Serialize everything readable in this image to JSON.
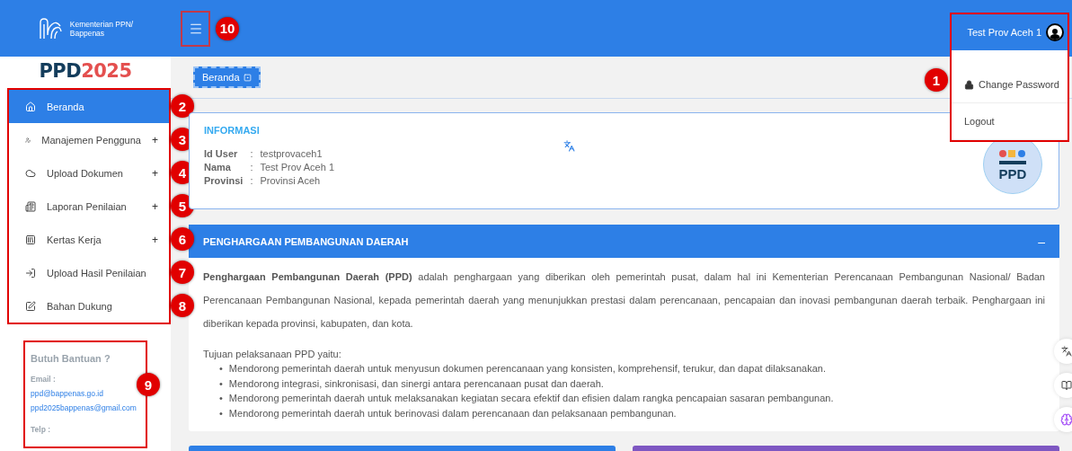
{
  "header": {
    "brand_lines": [
      "Kementerian PPN/",
      "Bappenas"
    ],
    "menu_marker": "10",
    "user_name": "Test Prov Aceh 1"
  },
  "user_menu": {
    "marker": "1",
    "items": [
      {
        "label": "Change Password",
        "kind": "lock"
      },
      {
        "label": "Logout",
        "kind": "plain"
      }
    ]
  },
  "sidebar": {
    "logo": [
      "PPD",
      "2025"
    ],
    "items": [
      {
        "label": "Beranda",
        "selected": true,
        "marker": "2"
      },
      {
        "label": "Manajemen Pengguna",
        "selected": false,
        "expand": "+",
        "marker": "3"
      },
      {
        "label": "Upload Dokumen",
        "selected": false,
        "expand": "+",
        "marker": "4"
      },
      {
        "label": "Laporan Penilaian",
        "selected": false,
        "expand": "+",
        "marker": "5"
      },
      {
        "label": "Kertas Kerja",
        "selected": false,
        "expand": "+",
        "marker": "6"
      },
      {
        "label": "Upload Hasil Penilaian",
        "selected": false,
        "marker": "7"
      },
      {
        "label": "Bahan Dukung",
        "selected": false,
        "marker": "8"
      }
    ],
    "help": {
      "marker": "9",
      "title": "Butuh Bantuan ?",
      "email_label": "Email :",
      "emails": [
        "ppd@bappenas.go.id",
        "ppd2025bappenas@gmail.com"
      ],
      "phone_label": "Telp :"
    }
  },
  "breadcrumb": {
    "label": "Beranda"
  },
  "info": {
    "title": "INFORMASI",
    "fields": [
      {
        "label": "Id User",
        "separator": ":",
        "value": "testprovaceh1"
      },
      {
        "label": "Nama",
        "separator": ":",
        "value": "Test Prov Aceh 1"
      },
      {
        "label": "Provinsi",
        "separator": ":",
        "value": "Provinsi Aceh"
      }
    ],
    "badge": "PPD"
  },
  "section": {
    "title": "PENGHARGAAN PEMBANGUNAN DAERAH",
    "toggle": "–",
    "paragraph": "**Penghargaan Pembangunan Daerah (PPD)** adalah penghargaan yang diberikan oleh pemerintah pusat, dalam hal ini Kementerian Perencanaan Pembangunan Nasional/ Badan Perencanaan Pembangunan Nasional, kepada pemerintah daerah yang menunjukkan prestasi dalam perencanaan, pencapaian dan inovasi pembangunan daerah terbaik. Penghargaan ini diberikan kepada provinsi, kabupaten, dan kota.",
    "intro": "Tujuan pelaksanaan PPD yaitu:",
    "bullet": "•",
    "bullets": [
      "Mendorong pemerintah daerah untuk menyusun dokumen perencanaan yang konsisten, komprehensif, terukur, dan dapat dilaksanakan.",
      "Mendorong integrasi, sinkronisasi, dan sinergi antara perencanaan pusat dan daerah.",
      "Mendorong pemerintah daerah untuk melaksanakan kegiatan secara efektif dan efisien dalam rangka pencapaian sasaran pembangunan.",
      "Mendorong pemerintah daerah untuk berinovasi dalam perencanaan dan pelaksanaan pembangunan."
    ]
  },
  "bottom_cards": [
    {
      "color": "#2d7fe6"
    },
    {
      "color": "#7e57c2"
    }
  ]
}
